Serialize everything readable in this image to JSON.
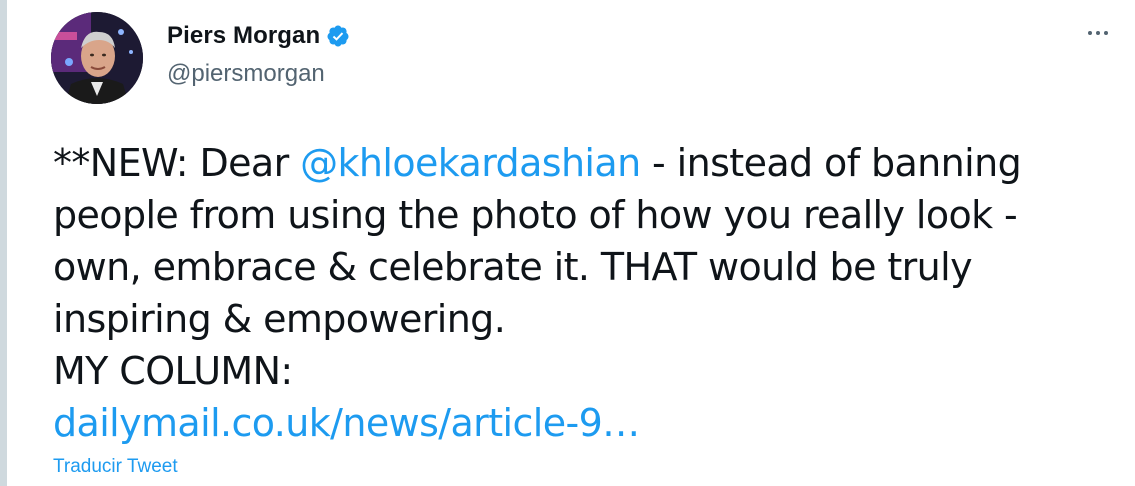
{
  "author": {
    "display_name": "Piers Morgan",
    "handle": "@piersmorgan",
    "verified": true
  },
  "tweet": {
    "line1_prefix": "**NEW: Dear ",
    "mention": "@khloekardashian",
    "line1_suffix": " - instead of banning",
    "line2": "people from using the photo of how you really look -",
    "line3": "own, embrace & celebrate it. THAT would be truly",
    "line4": "inspiring & empowering.",
    "line5": "MY COLUMN:",
    "link": "dailymail.co.uk/news/article-9…"
  },
  "actions": {
    "translate_label": "Traducir Tweet"
  },
  "icons": {
    "more": "more-options-icon",
    "verified": "verified-badge-icon"
  },
  "colors": {
    "accent": "#1d9bf0",
    "text": "#0f1419",
    "secondary": "#536471"
  }
}
